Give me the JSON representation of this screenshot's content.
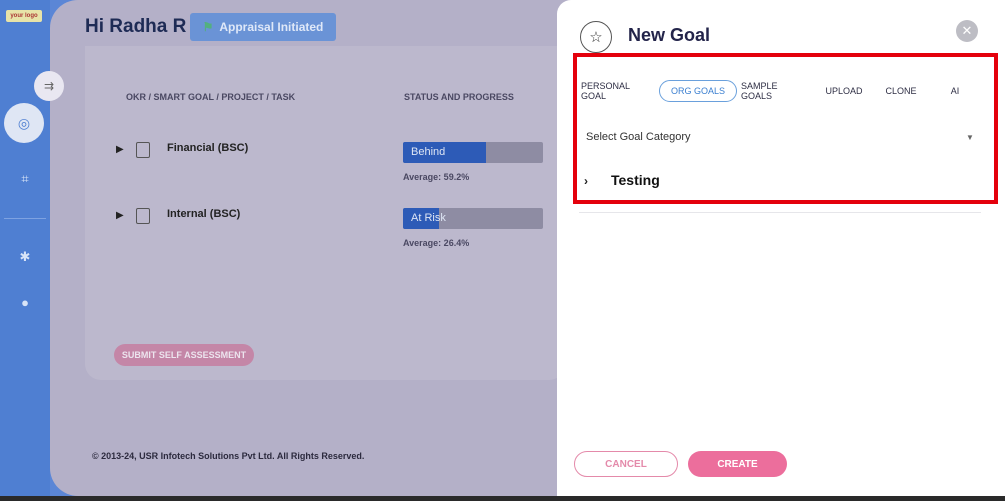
{
  "logo_text": "your logo",
  "header": {
    "greeting": "Hi Radha R",
    "appraisal_label": "Appraisal Initiated"
  },
  "table": {
    "col_goal": "OKR / SMART GOAL / PROJECT / TASK",
    "col_status": "STATUS AND PROGRESS",
    "rows": [
      {
        "label": "Financial (BSC)",
        "status": "Behind",
        "progress_fraction": 0.59,
        "average": "Average: 59.2%"
      },
      {
        "label": "Internal (BSC)",
        "status": "At Risk",
        "progress_fraction": 0.26,
        "average": "Average: 26.4%"
      }
    ]
  },
  "submit_label": "SUBMIT SELF ASSESSMENT",
  "footer": "© 2013-24, USR Infotech Solutions Pvt Ltd. All Rights Reserved.",
  "drawer": {
    "title": "New Goal",
    "tabs": [
      "PERSONAL GOAL",
      "ORG GOALS",
      "SAMPLE GOALS",
      "UPLOAD",
      "CLONE",
      "AI"
    ],
    "active_tab": "ORG GOALS",
    "category_placeholder": "Select Goal Category",
    "group_label": "Testing",
    "cancel_label": "CANCEL",
    "create_label": "CREATE"
  },
  "colors": {
    "accent_blue": "#2d5bb7",
    "pink": "#ec6e9c",
    "highlight_red": "#e4000c"
  }
}
